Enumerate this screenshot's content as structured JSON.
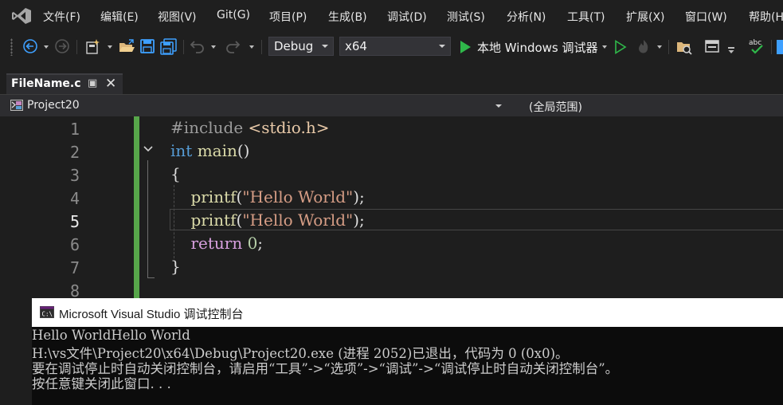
{
  "menu": {
    "items": [
      "文件(F)",
      "编辑(E)",
      "视图(V)",
      "Git(G)",
      "项目(P)",
      "生成(B)",
      "调试(D)",
      "测试(S)",
      "分析(N)",
      "工具(T)",
      "扩展(X)",
      "窗口(W)",
      "帮助(H"
    ]
  },
  "toolbar": {
    "configuration": "Debug",
    "platform": "x64",
    "run_label": "本地 Windows 调试器"
  },
  "tab": {
    "filename": "FileName.c",
    "pin_glyph": "▣",
    "close_glyph": "✕"
  },
  "navbar": {
    "project": "Project20",
    "scope": "(全局范围)"
  },
  "editor": {
    "line_numbers": [
      "1",
      "2",
      "3",
      "4",
      "5",
      "6",
      "7",
      "8"
    ],
    "current_line": "5",
    "code": {
      "l1_directive": "#include ",
      "l1_header": "<stdio.h>",
      "l2_type": "int",
      "l2_name": "main",
      "l2_parens": "()",
      "l3_open": "{",
      "l4_fn": "printf",
      "l4_open": "(",
      "l4_str": "\"Hello World\"",
      "l4_close": ");",
      "l5_fn": "printf",
      "l5_open": "(",
      "l5_str": "\"Hello World\"",
      "l5_close": ");",
      "l6_kw": "return",
      "l6_num": "0",
      "l6_end": ";",
      "l7_close": "}"
    }
  },
  "console": {
    "title": "Microsoft Visual Studio 调试控制台",
    "lines": [
      "Hello WorldHello World",
      "H:\\vs文件\\Project20\\x64\\Debug\\Project20.exe (进程 2052)已退出，代码为 0 (0x0)。",
      "要在调试停止时自动关闭控制台，请启用“工具”->“选项”->“调试”->“调试停止时自动关闭控制台”。",
      "按任意键关闭此窗口. . ."
    ]
  },
  "colors": {
    "change_bar": "#57a64a",
    "keyword": "#569cd6",
    "control_keyword": "#d8a0df",
    "function": "#dcdcaa",
    "string": "#d69d85",
    "number": "#b5cea8",
    "run_green": "#2fb84a",
    "accent_blue": "#3ea0ff"
  },
  "icons": [
    "visual-studio-logo-icon",
    "back-icon",
    "forward-icon",
    "new-project-icon",
    "open-folder-icon",
    "save-icon",
    "save-all-icon",
    "undo-icon",
    "redo-icon",
    "start-debug-icon",
    "start-without-debug-icon",
    "hot-reload-icon",
    "solution-explorer-icon",
    "layout-icon",
    "spell-check-icon",
    "pin-icon",
    "close-icon",
    "project-icon",
    "collapse-icon",
    "console-app-icon"
  ]
}
